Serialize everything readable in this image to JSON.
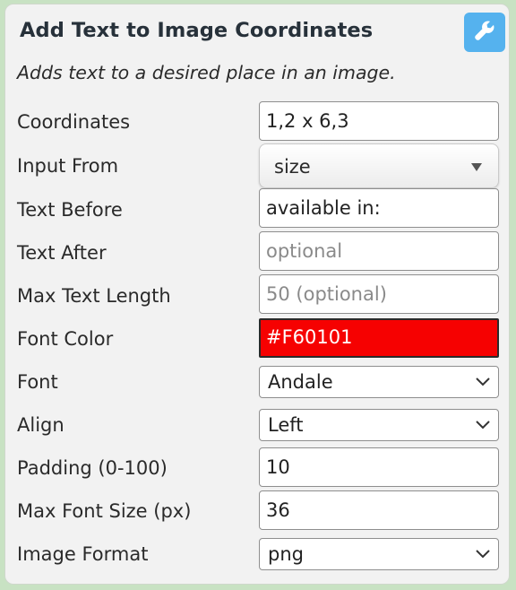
{
  "panel": {
    "title": "Add Text to Image Coordinates",
    "subtitle": "Adds text to a desired place in an image."
  },
  "icons": {
    "settings": "wrench-icon"
  },
  "colors": {
    "accent_button": "#55b2ee",
    "font_color_swatch": "#F60101"
  },
  "fields": {
    "coordinates": {
      "label": "Coordinates",
      "value": "1,2 x 6,3"
    },
    "input_from": {
      "label": "Input From",
      "value": "size"
    },
    "text_before": {
      "label": "Text Before",
      "value": "available in:"
    },
    "text_after": {
      "label": "Text After",
      "placeholder": "optional"
    },
    "max_text_length": {
      "label": "Max Text Length",
      "placeholder": "50 (optional)"
    },
    "font_color": {
      "label": "Font Color",
      "value": "#F60101"
    },
    "font": {
      "label": "Font",
      "value": "Andale"
    },
    "align": {
      "label": "Align",
      "value": "Left"
    },
    "padding": {
      "label": "Padding (0-100)",
      "value": "10"
    },
    "max_font_size": {
      "label": "Max Font Size (px)",
      "value": "36"
    },
    "image_format": {
      "label": "Image Format",
      "value": "png"
    }
  }
}
